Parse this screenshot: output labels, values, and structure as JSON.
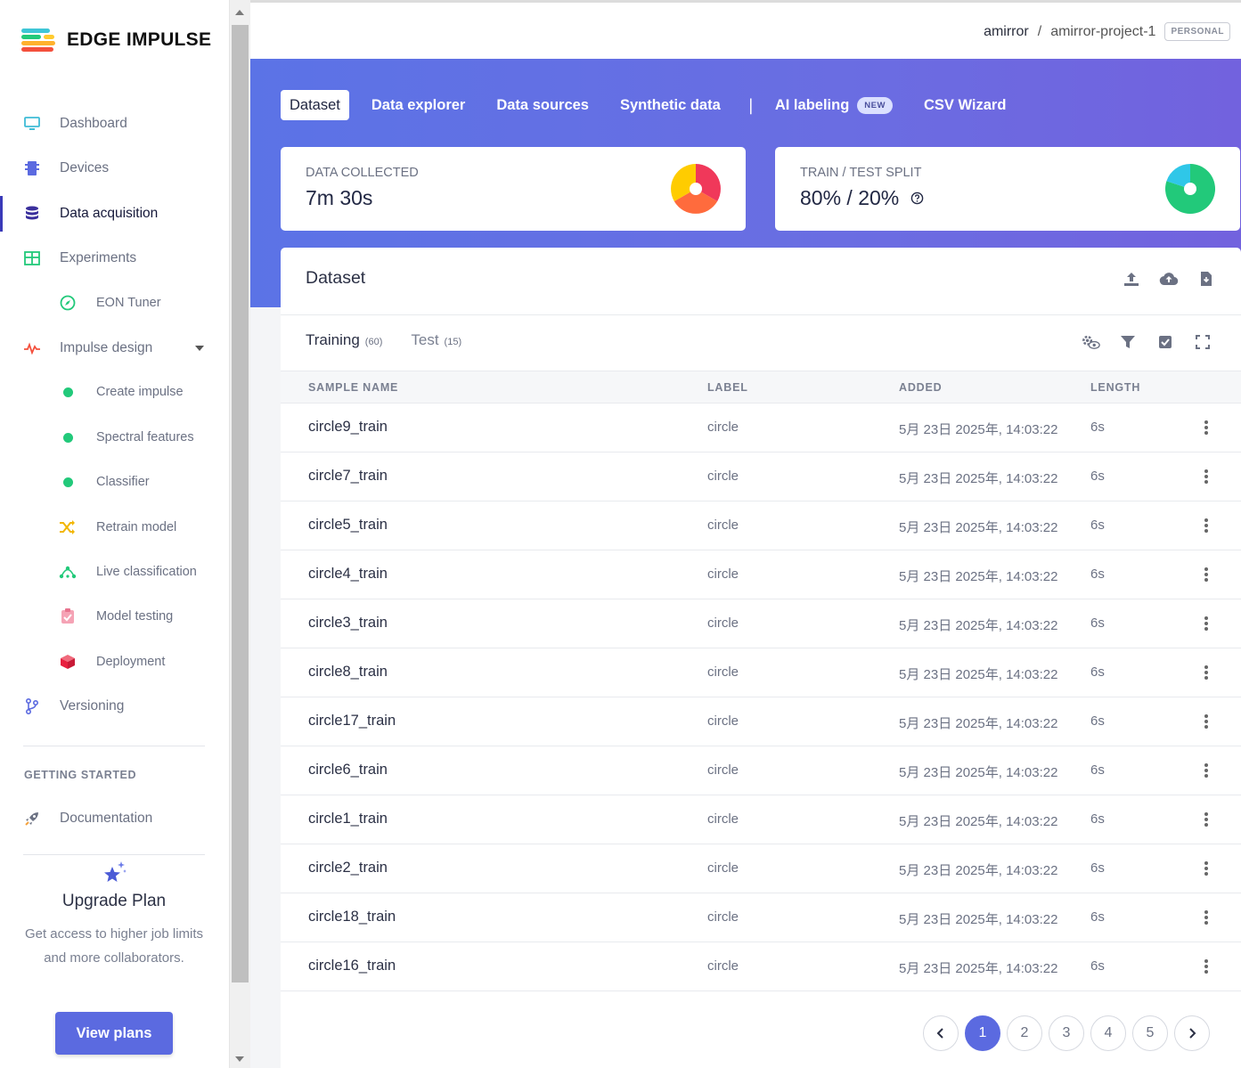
{
  "brand": {
    "name": "EDGE IMPULSE"
  },
  "nav": {
    "dashboard": "Dashboard",
    "devices": "Devices",
    "data_acquisition": "Data acquisition",
    "experiments": "Experiments",
    "eon_tuner": "EON Tuner",
    "impulse_design": "Impulse design",
    "create_impulse": "Create impulse",
    "spectral_features": "Spectral features",
    "classifier": "Classifier",
    "retrain_model": "Retrain model",
    "live_classification": "Live classification",
    "model_testing": "Model testing",
    "deployment": "Deployment",
    "versioning": "Versioning",
    "getting_started": "GETTING STARTED",
    "documentation": "Documentation"
  },
  "upgrade": {
    "title": "Upgrade Plan",
    "text": "Get access to higher job limits and more collaborators.",
    "button": "View plans"
  },
  "breadcrumb": {
    "user": "amirror",
    "separator": "/",
    "project": "amirror-project-1",
    "badge": "PERSONAL"
  },
  "tabs": {
    "dataset": "Dataset",
    "data_explorer": "Data explorer",
    "data_sources": "Data sources",
    "synthetic_data": "Synthetic data",
    "separator": "|",
    "ai_labeling": "AI labeling",
    "new_badge": "NEW",
    "csv_wizard": "CSV Wizard"
  },
  "stats": {
    "collected_label": "DATA COLLECTED",
    "collected_value": "7m 30s",
    "split_label": "TRAIN / TEST SPLIT",
    "split_value": "80% / 20%"
  },
  "dataset": {
    "title": "Dataset",
    "training_label": "Training",
    "training_count": "(60)",
    "test_label": "Test",
    "test_count": "(15)",
    "columns": {
      "name": "SAMPLE NAME",
      "label": "LABEL",
      "added": "ADDED",
      "length": "LENGTH"
    },
    "rows": [
      {
        "name": "circle9_train",
        "label": "circle",
        "added": "5月 23日 2025年, 14:03:22",
        "length": "6s"
      },
      {
        "name": "circle7_train",
        "label": "circle",
        "added": "5月 23日 2025年, 14:03:22",
        "length": "6s"
      },
      {
        "name": "circle5_train",
        "label": "circle",
        "added": "5月 23日 2025年, 14:03:22",
        "length": "6s"
      },
      {
        "name": "circle4_train",
        "label": "circle",
        "added": "5月 23日 2025年, 14:03:22",
        "length": "6s"
      },
      {
        "name": "circle3_train",
        "label": "circle",
        "added": "5月 23日 2025年, 14:03:22",
        "length": "6s"
      },
      {
        "name": "circle8_train",
        "label": "circle",
        "added": "5月 23日 2025年, 14:03:22",
        "length": "6s"
      },
      {
        "name": "circle17_train",
        "label": "circle",
        "added": "5月 23日 2025年, 14:03:22",
        "length": "6s"
      },
      {
        "name": "circle6_train",
        "label": "circle",
        "added": "5月 23日 2025年, 14:03:22",
        "length": "6s"
      },
      {
        "name": "circle1_train",
        "label": "circle",
        "added": "5月 23日 2025年, 14:03:22",
        "length": "6s"
      },
      {
        "name": "circle2_train",
        "label": "circle",
        "added": "5月 23日 2025年, 14:03:22",
        "length": "6s"
      },
      {
        "name": "circle18_train",
        "label": "circle",
        "added": "5月 23日 2025年, 14:03:22",
        "length": "6s"
      },
      {
        "name": "circle16_train",
        "label": "circle",
        "added": "5月 23日 2025年, 14:03:22",
        "length": "6s"
      }
    ]
  },
  "pagination": {
    "pages": [
      "1",
      "2",
      "3",
      "4",
      "5"
    ],
    "current": "1"
  },
  "colors": {
    "accent": "#5b6ae0",
    "hero_start": "#5b73e6",
    "hero_end": "#7262de",
    "green": "#22c97a",
    "active_nav": "#3a3ab8"
  },
  "icons": {
    "dashboard": "monitor-icon",
    "devices": "chip-icon",
    "data_acquisition": "database-icon",
    "experiments": "table-icon",
    "eon_tuner": "compass-icon",
    "impulse_design": "pulse-icon",
    "retrain_model": "shuffle-icon",
    "live_classification": "network-icon",
    "model_testing": "clipboard-check-icon",
    "deployment": "cube-icon",
    "versioning": "branch-icon",
    "documentation": "rocket-icon",
    "upgrade": "sparkle-star-icon"
  }
}
